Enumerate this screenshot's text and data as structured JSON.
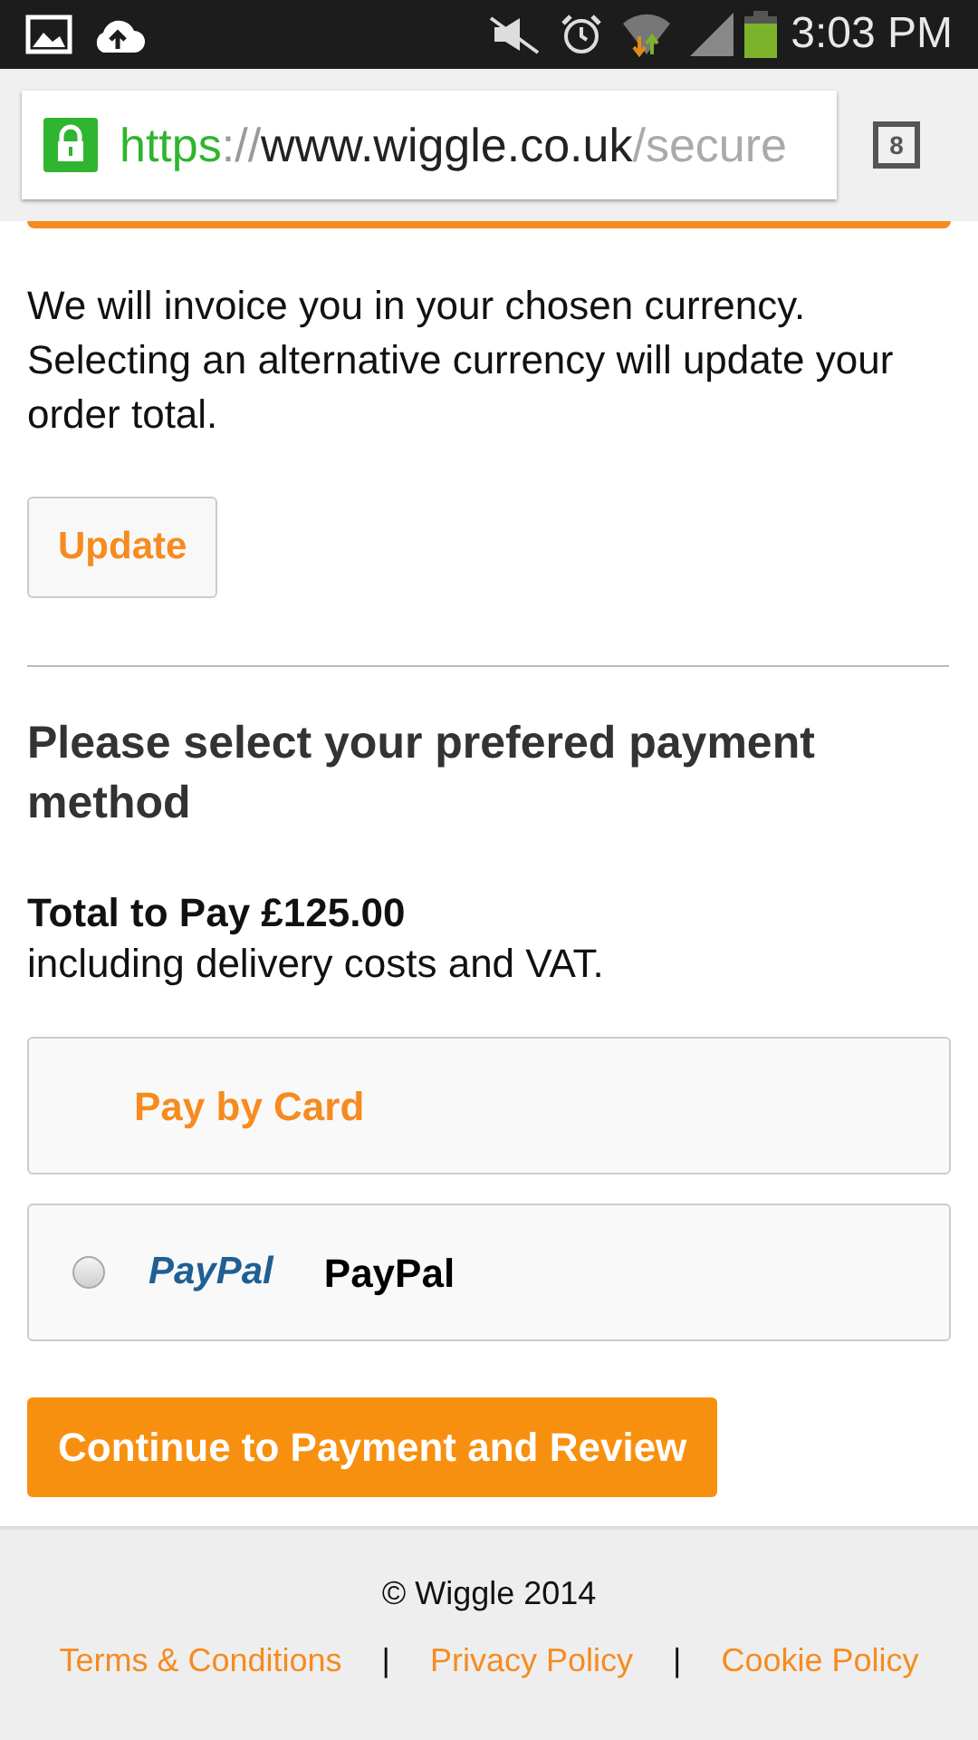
{
  "status_bar": {
    "time": "3:03 PM"
  },
  "browser": {
    "url": {
      "scheme": "https",
      "separator": "://",
      "host": "www.wiggle.co.uk",
      "path": "/secure"
    },
    "secure": true,
    "tab_count": "8"
  },
  "currency_note": "We will invoice you in your chosen currency. Selecting an alternative currency will update your order total.",
  "update_button": "Update",
  "payment_heading": "Please select your prefered payment method",
  "total": "Total to Pay £125.00",
  "total_note": "including delivery costs and VAT.",
  "payment_options": [
    {
      "kind": "link",
      "label": "Pay by Card",
      "selected": false
    },
    {
      "kind": "radio",
      "logo": "PayPal",
      "label": "PayPal",
      "selected": false
    }
  ],
  "continue_button": "Continue to Payment and Review",
  "footer": {
    "copyright": "© Wiggle 2014",
    "links": [
      "Terms & Conditions",
      "Privacy Policy",
      "Cookie Policy"
    ],
    "separator": "|"
  }
}
